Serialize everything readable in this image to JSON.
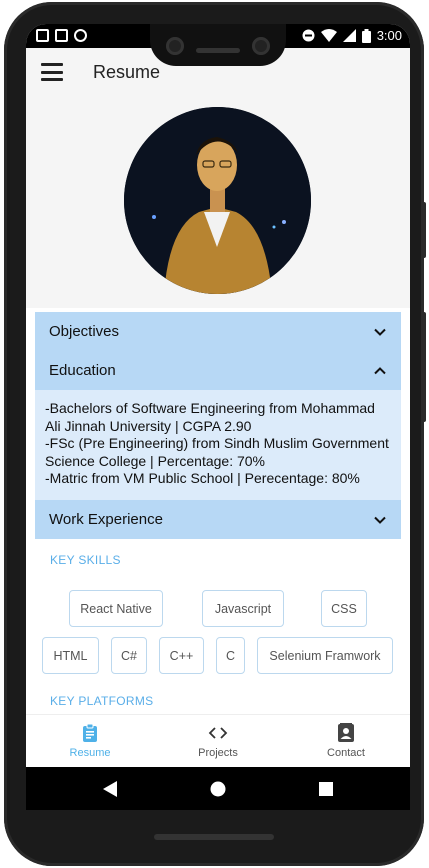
{
  "status_bar": {
    "time": "3:00"
  },
  "app_bar": {
    "title": "Resume"
  },
  "accordion": {
    "objectives": "Objectives",
    "education": "Education",
    "education_lines": [
      "-Bachelors of Software Engineering from Mohammad Ali Jinnah University | CGPA 2.90",
      "-FSc (Pre Engineering) from Sindh Muslim Government Science College | Percentage: 70%",
      "-Matric from VM Public School | Perecentage: 80%"
    ],
    "work_experience": "Work Experience"
  },
  "key_skills": {
    "label": "KEY SKILLS",
    "chips": [
      "React Native",
      "Javascript",
      "CSS",
      "HTML",
      "C#",
      "C++",
      "C",
      "Selenium Framwork"
    ]
  },
  "key_platforms": {
    "label": "KEY PLATFORMS"
  },
  "tabs": [
    {
      "label": "Resume",
      "icon": "clipboard-icon",
      "active": true
    },
    {
      "label": "Projects",
      "icon": "code-icon",
      "active": false
    },
    {
      "label": "Contact",
      "icon": "contact-card-icon",
      "active": false
    }
  ],
  "colors": {
    "accent": "#4fb1e8",
    "accordion_header": "#b7d8f5",
    "accordion_body": "#dcebfa"
  }
}
